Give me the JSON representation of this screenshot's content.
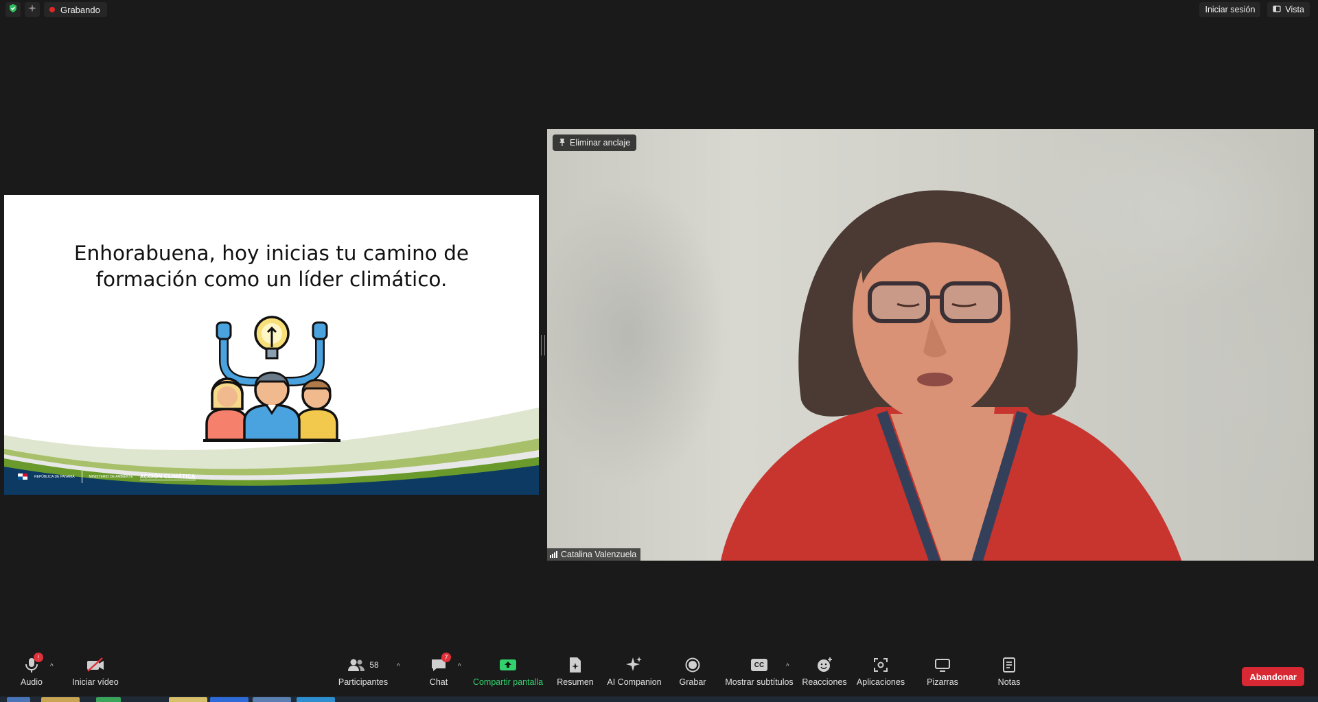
{
  "topbar": {
    "recording_label": "Grabando",
    "sign_in_label": "Iniciar sesión",
    "view_label": "Vista",
    "shield_icon": "shield-check-icon",
    "spark_icon": "sparkle-icon"
  },
  "slide": {
    "title_line1": "Enhorabuena, hoy inicias tu camino de",
    "title_line2": "formación como un líder climático.",
    "logo_republic": "REPÚBLICA DE PANAMÁ",
    "logo_ministry": "MINISTERIO DE AMBIENTE",
    "logo_accion": "ACCIÓN CLIMÁTICA"
  },
  "video": {
    "pin_label": "Eliminar anclaje",
    "participant_name": "Catalina Valenzuela"
  },
  "toolbar": {
    "audio_label": "Audio",
    "audio_badge": "!",
    "video_label": "Iniciar vídeo",
    "participants_label": "Participantes",
    "participants_count": "58",
    "chat_label": "Chat",
    "chat_badge": "7",
    "share_label": "Compartir pantalla",
    "summary_label": "Resumen",
    "ai_label": "AI Companion",
    "record_label": "Grabar",
    "captions_label": "Mostrar subtítulos",
    "captions_icon_text": "CC",
    "reactions_label": "Reacciones",
    "apps_label": "Aplicaciones",
    "whiteboards_label": "Pizarras",
    "notes_label": "Notas",
    "leave_label": "Abandonar"
  },
  "colors": {
    "background": "#1a1a1a",
    "share_green": "#31d26d",
    "leave_red": "#d72833",
    "slide_navy": "#0d3a63",
    "slide_green": "#6a9a2c"
  }
}
